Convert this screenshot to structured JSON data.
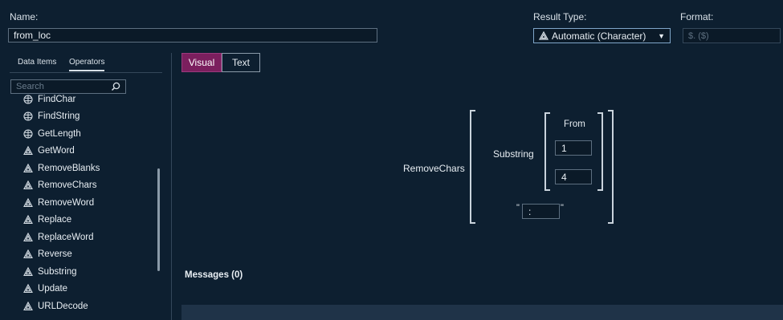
{
  "form": {
    "name_label": "Name:",
    "name_value": "from_loc",
    "result_type_label": "Result Type:",
    "result_type_value": "Automatic (Character)",
    "format_label": "Format:",
    "format_value": "$. ($)"
  },
  "sidebar": {
    "tabs": [
      {
        "label": "Data Items"
      },
      {
        "label": "Operators"
      }
    ],
    "search_placeholder": "Search",
    "items": [
      {
        "label": "FindChar",
        "icon": "globe-icon"
      },
      {
        "label": "FindString",
        "icon": "globe-icon"
      },
      {
        "label": "GetLength",
        "icon": "globe-icon"
      },
      {
        "label": "GetWord",
        "icon": "character-icon"
      },
      {
        "label": "RemoveBlanks",
        "icon": "character-icon"
      },
      {
        "label": "RemoveChars",
        "icon": "character-icon"
      },
      {
        "label": "RemoveWord",
        "icon": "character-icon"
      },
      {
        "label": "Replace",
        "icon": "character-icon"
      },
      {
        "label": "ReplaceWord",
        "icon": "character-icon"
      },
      {
        "label": "Reverse",
        "icon": "character-icon"
      },
      {
        "label": "Substring",
        "icon": "character-icon"
      },
      {
        "label": "Update",
        "icon": "character-icon"
      },
      {
        "label": "URLDecode",
        "icon": "character-icon"
      }
    ]
  },
  "editor": {
    "view_tabs": [
      {
        "label": "Visual"
      },
      {
        "label": "Text"
      }
    ],
    "outer_function": "RemoveChars",
    "inner_function": "Substring",
    "from_label": "From",
    "arg1": "1",
    "arg2": "4",
    "string_arg": ":",
    "quote_open": "\"",
    "quote_close": "\""
  },
  "messages": {
    "label": "Messages (0)"
  },
  "colors": {
    "background": "#0d1f30",
    "accent": "#7b1f5e",
    "border": "#5d6f80"
  }
}
